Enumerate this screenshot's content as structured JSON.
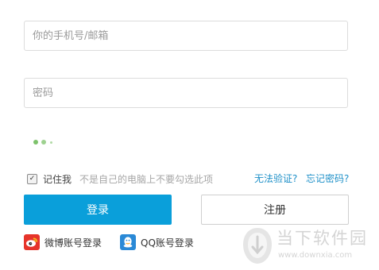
{
  "form": {
    "phone_placeholder": "你的手机号/邮箱",
    "password_placeholder": "密码"
  },
  "remember": {
    "label": "记住我",
    "hint": "不是自己的电脑上不要勾选此项",
    "checked": true
  },
  "links": {
    "verify": "无法验证?",
    "forgot": "忘记密码?"
  },
  "buttons": {
    "login": "登录",
    "register": "注册"
  },
  "social": {
    "weibo": "微博账号登录",
    "qq": "QQ账号登录"
  },
  "watermark": {
    "title": "当下软件园",
    "url": "www.downxia.com"
  },
  "colors": {
    "primary": "#0a9fda",
    "link": "#1e90c8",
    "loader": "#7dc26b",
    "weibo": "#e6342a",
    "qq": "#2a89d6"
  },
  "icons": [
    "loading-indicator",
    "checkbox-check-icon",
    "weibo-icon",
    "qq-icon",
    "downxia-logo"
  ]
}
